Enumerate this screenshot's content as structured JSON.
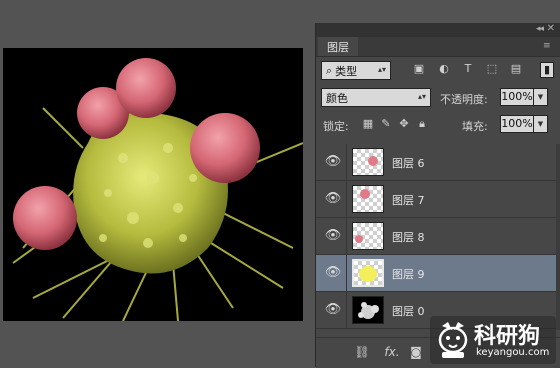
{
  "panel": {
    "tab_label": "图层",
    "collapse_icon": "double-chevron-icon",
    "close_icon": "close-icon"
  },
  "filter": {
    "kind_label": "类型",
    "search_icon": "search-icon"
  },
  "blend": {
    "mode": "颜色",
    "opacity_label": "不透明度:",
    "opacity_value": "100%"
  },
  "locks": {
    "label": "锁定:",
    "fill_label": "填充:",
    "fill_value": "100%"
  },
  "layers": [
    {
      "name": "图层 6",
      "selected": false
    },
    {
      "name": "图层 7",
      "selected": false
    },
    {
      "name": "图层 8",
      "selected": false
    },
    {
      "name": "图层 9",
      "selected": true
    },
    {
      "name": "图层 0",
      "selected": false
    }
  ],
  "footer": {
    "fx_label": "fx."
  },
  "watermark": {
    "brand": "科研狗",
    "url": "keyangou.com"
  },
  "colors": {
    "panel_bg": "#474747",
    "selected_row": "#6d7a8c",
    "cell_pink": "#d9707d",
    "cell_yellow": "#c4c94a"
  }
}
